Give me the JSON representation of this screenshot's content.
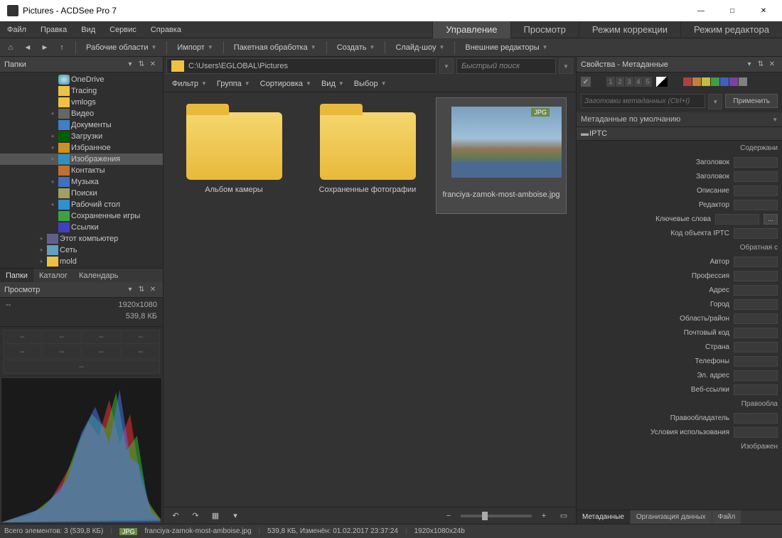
{
  "window": {
    "title": "Pictures - ACDSee Pro 7"
  },
  "menu": {
    "file": "Файл",
    "edit": "Правка",
    "view": "Вид",
    "service": "Сервис",
    "help": "Справка"
  },
  "modes": {
    "manage": "Управление",
    "view": "Просмотр",
    "develop": "Режим коррекции",
    "edit": "Режим редактора"
  },
  "toolbar": {
    "workspaces": "Рабочие области",
    "import": "Импорт",
    "batch": "Пакетная обработка",
    "create": "Создать",
    "slideshow": "Слайд-шоу",
    "external": "Внешние редакторы"
  },
  "folders": {
    "panel_title": "Папки",
    "items": [
      {
        "label": "OneDrive",
        "icon": "onedrive",
        "indent": 3,
        "exp": ""
      },
      {
        "label": "Tracing",
        "icon": "folder",
        "indent": 3,
        "exp": ""
      },
      {
        "label": "vmlogs",
        "icon": "folder",
        "indent": 3,
        "exp": ""
      },
      {
        "label": "Видео",
        "icon": "video",
        "indent": 3,
        "exp": "+"
      },
      {
        "label": "Документы",
        "icon": "doc",
        "indent": 3,
        "exp": ""
      },
      {
        "label": "Загрузки",
        "icon": "download",
        "indent": 3,
        "exp": "+"
      },
      {
        "label": "Избранное",
        "icon": "fav",
        "indent": 3,
        "exp": "+"
      },
      {
        "label": "Изображения",
        "icon": "images",
        "indent": 3,
        "exp": "+",
        "selected": true
      },
      {
        "label": "Контакты",
        "icon": "contacts",
        "indent": 3,
        "exp": ""
      },
      {
        "label": "Музыка",
        "icon": "music",
        "indent": 3,
        "exp": "+"
      },
      {
        "label": "Поиски",
        "icon": "search",
        "indent": 3,
        "exp": ""
      },
      {
        "label": "Рабочий стол",
        "icon": "desktop",
        "indent": 3,
        "exp": "+"
      },
      {
        "label": "Сохраненные игры",
        "icon": "games",
        "indent": 3,
        "exp": ""
      },
      {
        "label": "Ссылки",
        "icon": "links",
        "indent": 3,
        "exp": ""
      },
      {
        "label": "Этот компьютер",
        "icon": "computer",
        "indent": 2,
        "exp": "+"
      },
      {
        "label": "Сеть",
        "icon": "network",
        "indent": 2,
        "exp": "+"
      },
      {
        "label": "mold",
        "icon": "mold",
        "indent": 2,
        "exp": "+"
      }
    ],
    "tabs": {
      "folders": "Папки",
      "catalog": "Каталог",
      "calendar": "Календарь"
    }
  },
  "preview_panel": {
    "title": "Просмотр",
    "left1": "--",
    "right1": "1920x1080",
    "left2": "",
    "right2": "539,8 КБ"
  },
  "path": "C:\\Users\\EGLOBAL\\Pictures",
  "search_placeholder": "Быстрый поиск",
  "filters": {
    "filter": "Фильтр",
    "group": "Группа",
    "sort": "Сортировка",
    "view": "Вид",
    "select": "Выбор"
  },
  "thumbs": [
    {
      "label": "Альбом камеры",
      "type": "folder"
    },
    {
      "label": "Сохраненные фотографии",
      "type": "folder"
    },
    {
      "label": "franciya-zamok-most-amboise.jpg",
      "type": "image",
      "badge": "JPG",
      "selected": true
    }
  ],
  "properties": {
    "panel_title": "Свойства - Метаданные",
    "colors": [
      "#b04040",
      "#c08040",
      "#c0c040",
      "#40a040",
      "#4060c0",
      "#8040a0",
      "#808080"
    ],
    "meta_placeholder": "Заготовки метаданных (Ctrl+I)",
    "apply": "Применить",
    "default_meta": "Метаданные по умолчанию",
    "section": "IPTC",
    "fields": [
      "Содержани",
      "Заголовок",
      "Заголовок",
      "Описание",
      "Редактор",
      "Ключевые слова",
      "Код объекта IPTC",
      "Обратная с",
      "Автор",
      "Профессия",
      "Адрес",
      "Город",
      "Область/район",
      "Почтовый код",
      "Страна",
      "Телефоны",
      "Эл. адрес",
      "Веб-ссылки",
      "Правообла",
      "Правообладатель",
      "Условия использования",
      "Изображен"
    ],
    "tabs": {
      "meta": "Метаданные",
      "org": "Организация данных",
      "file": "Файл"
    }
  },
  "status": {
    "total": "Всего элементов: 3  (539,8 КБ)",
    "badge": "JPG",
    "filename": "franciya-zamok-most-amboise.jpg",
    "info": "539,8 КБ, Изменён: 01.02.2017 23:37:24",
    "dims": "1920x1080x24b"
  }
}
